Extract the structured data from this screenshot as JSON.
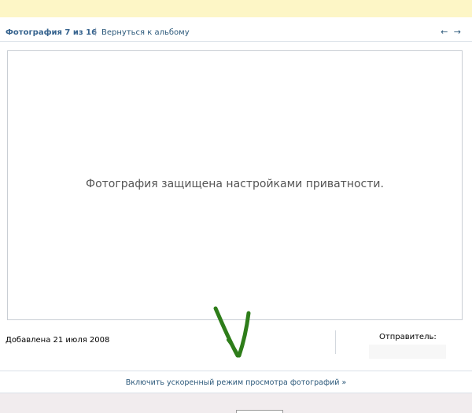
{
  "header": {
    "photo_counter": "Фотография 7 из 16",
    "separator": "|",
    "back_link": "Вернуться к альбому",
    "prev_arrow": "←",
    "next_arrow": "→"
  },
  "photo": {
    "privacy_message": "Фотография защищена настройками приватности."
  },
  "info": {
    "added_date": "Добавлена 21 июля 2008",
    "sender_label": "Отправитель:"
  },
  "footer": {
    "fast_mode_link": "Включить ускоренный режим просмотра фотографий »"
  },
  "colors": {
    "banner": "#fdf6c6",
    "link": "#2b587a",
    "annotation_arrow": "#2e7d1a"
  },
  "icons": {
    "annotation": "hand-drawn-down-arrow"
  }
}
